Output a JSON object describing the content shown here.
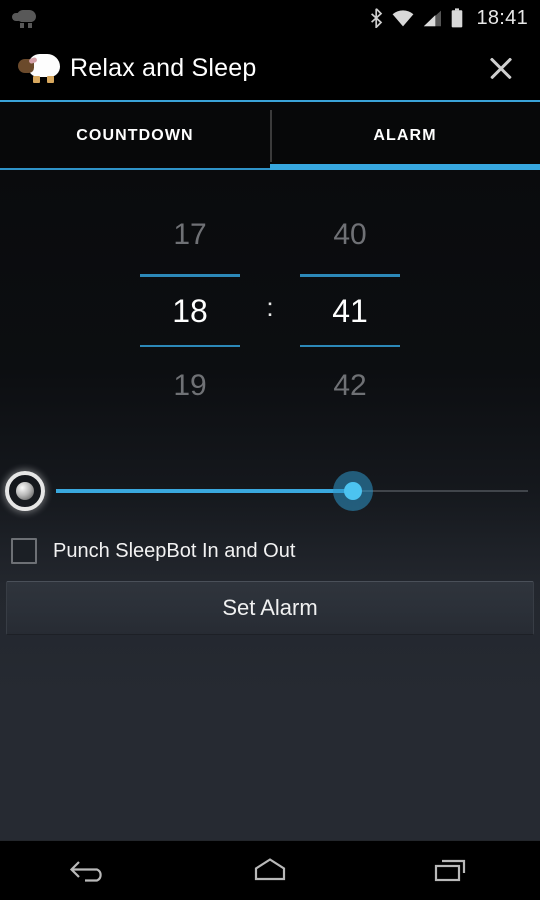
{
  "status_bar": {
    "notification_icon": "sheep-icon",
    "icons": [
      "bluetooth-icon",
      "wifi-icon",
      "cellular-signal-icon",
      "battery-icon"
    ],
    "clock": "18:41"
  },
  "app_bar": {
    "logo_icon": "sheep-logo-icon",
    "title": "Relax and Sleep",
    "close_label": "close-icon"
  },
  "tabs": [
    {
      "label": "COUNTDOWN",
      "active": false
    },
    {
      "label": "ALARM",
      "active": true
    }
  ],
  "time_picker": {
    "hour": {
      "previous": "17",
      "selected": "18",
      "next": "19"
    },
    "separator": ":",
    "minute": {
      "previous": "40",
      "selected": "41",
      "next": "42"
    }
  },
  "volume_slider": {
    "icon": "volume-icon",
    "percent": 63
  },
  "punch_checkbox": {
    "label": "Punch SleepBot In and Out",
    "checked": false
  },
  "set_alarm_button": {
    "label": "Set Alarm"
  },
  "nav_bar": {
    "back": "back-icon",
    "home": "home-icon",
    "recents": "recents-icon"
  },
  "colors": {
    "accent": "#37a8e0",
    "accent_dim": "#2c88b8",
    "background": "#0a0b0d",
    "panel": "#262a32",
    "text": "#ffffff",
    "text_dim": "#6f7175"
  }
}
